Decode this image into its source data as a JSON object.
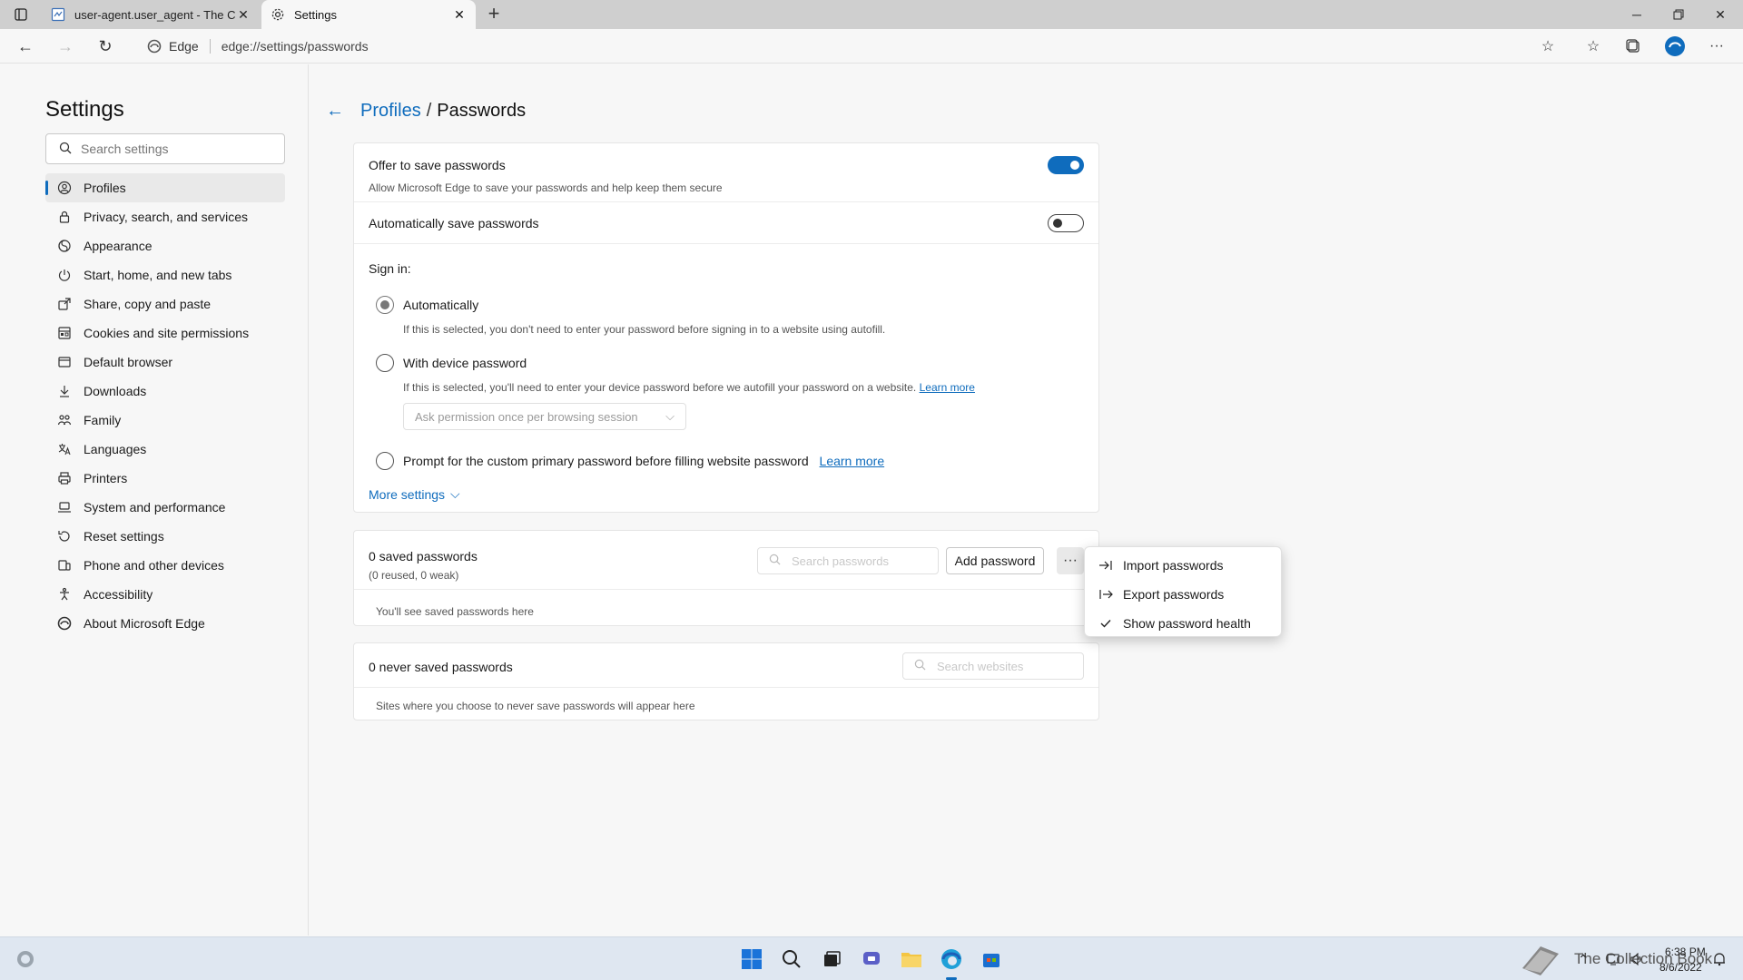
{
  "browser": {
    "tabs": [
      {
        "title": "user-agent.user_agent - The Coll",
        "active": false
      },
      {
        "title": "Settings",
        "active": true
      }
    ],
    "new_tab": "+",
    "brand": "Edge",
    "url": "edge://settings/passwords"
  },
  "sidebar": {
    "title": "Settings",
    "search_placeholder": "Search settings",
    "items": [
      {
        "label": "Profiles",
        "icon": "profile-icon",
        "active": true
      },
      {
        "label": "Privacy, search, and services",
        "icon": "lock-icon"
      },
      {
        "label": "Appearance",
        "icon": "appearance-icon"
      },
      {
        "label": "Start, home, and new tabs",
        "icon": "power-icon"
      },
      {
        "label": "Share, copy and paste",
        "icon": "share-icon"
      },
      {
        "label": "Cookies and site permissions",
        "icon": "cookie-icon"
      },
      {
        "label": "Default browser",
        "icon": "browser-icon"
      },
      {
        "label": "Downloads",
        "icon": "download-icon"
      },
      {
        "label": "Family",
        "icon": "family-icon"
      },
      {
        "label": "Languages",
        "icon": "language-icon"
      },
      {
        "label": "Printers",
        "icon": "printer-icon"
      },
      {
        "label": "System and performance",
        "icon": "laptop-icon"
      },
      {
        "label": "Reset settings",
        "icon": "reset-icon"
      },
      {
        "label": "Phone and other devices",
        "icon": "phone-icon"
      },
      {
        "label": "Accessibility",
        "icon": "accessibility-icon"
      },
      {
        "label": "About Microsoft Edge",
        "icon": "edge-logo-icon"
      }
    ]
  },
  "breadcrumb": {
    "parent": "Profiles",
    "separator": "/",
    "current": "Passwords"
  },
  "settings": {
    "offer_title": "Offer to save passwords",
    "offer_desc": "Allow Microsoft Edge to save your passwords and help keep them secure",
    "offer_on": true,
    "auto_title": "Automatically save passwords",
    "auto_on": false,
    "signin_label": "Sign in:",
    "opt_auto_label": "Automatically",
    "opt_auto_desc": "If this is selected, you don't need to enter your password before signing in to a website using autofill.",
    "opt_device_label": "With device password",
    "opt_device_desc": "If this is selected, you'll need to enter your device password before we autofill your password on a website.",
    "learn_more": "Learn more",
    "device_select": "Ask permission once per browsing session",
    "opt_custom_label": "Prompt for the custom primary password before filling website password",
    "more_settings": "More settings"
  },
  "saved": {
    "title": "0 saved passwords",
    "subtitle": "(0 reused, 0 weak)",
    "search_placeholder": "Search passwords",
    "add_button": "Add password",
    "more_button": "···",
    "empty": "You'll see saved passwords here"
  },
  "never": {
    "title": "0 never saved passwords",
    "search_placeholder": "Search websites",
    "empty": "Sites where you choose to never save passwords will appear here"
  },
  "menu": {
    "items": [
      {
        "label": "Import passwords",
        "icon": "import-icon"
      },
      {
        "label": "Export passwords",
        "icon": "export-icon"
      },
      {
        "label": "Show password health",
        "icon": "checkmark-icon"
      }
    ]
  },
  "taskbar": {
    "tray_text": "The Collection Book",
    "time": "6:38 PM",
    "date": "8/6/2022"
  },
  "colors": {
    "accent": "#0f6cbd"
  }
}
